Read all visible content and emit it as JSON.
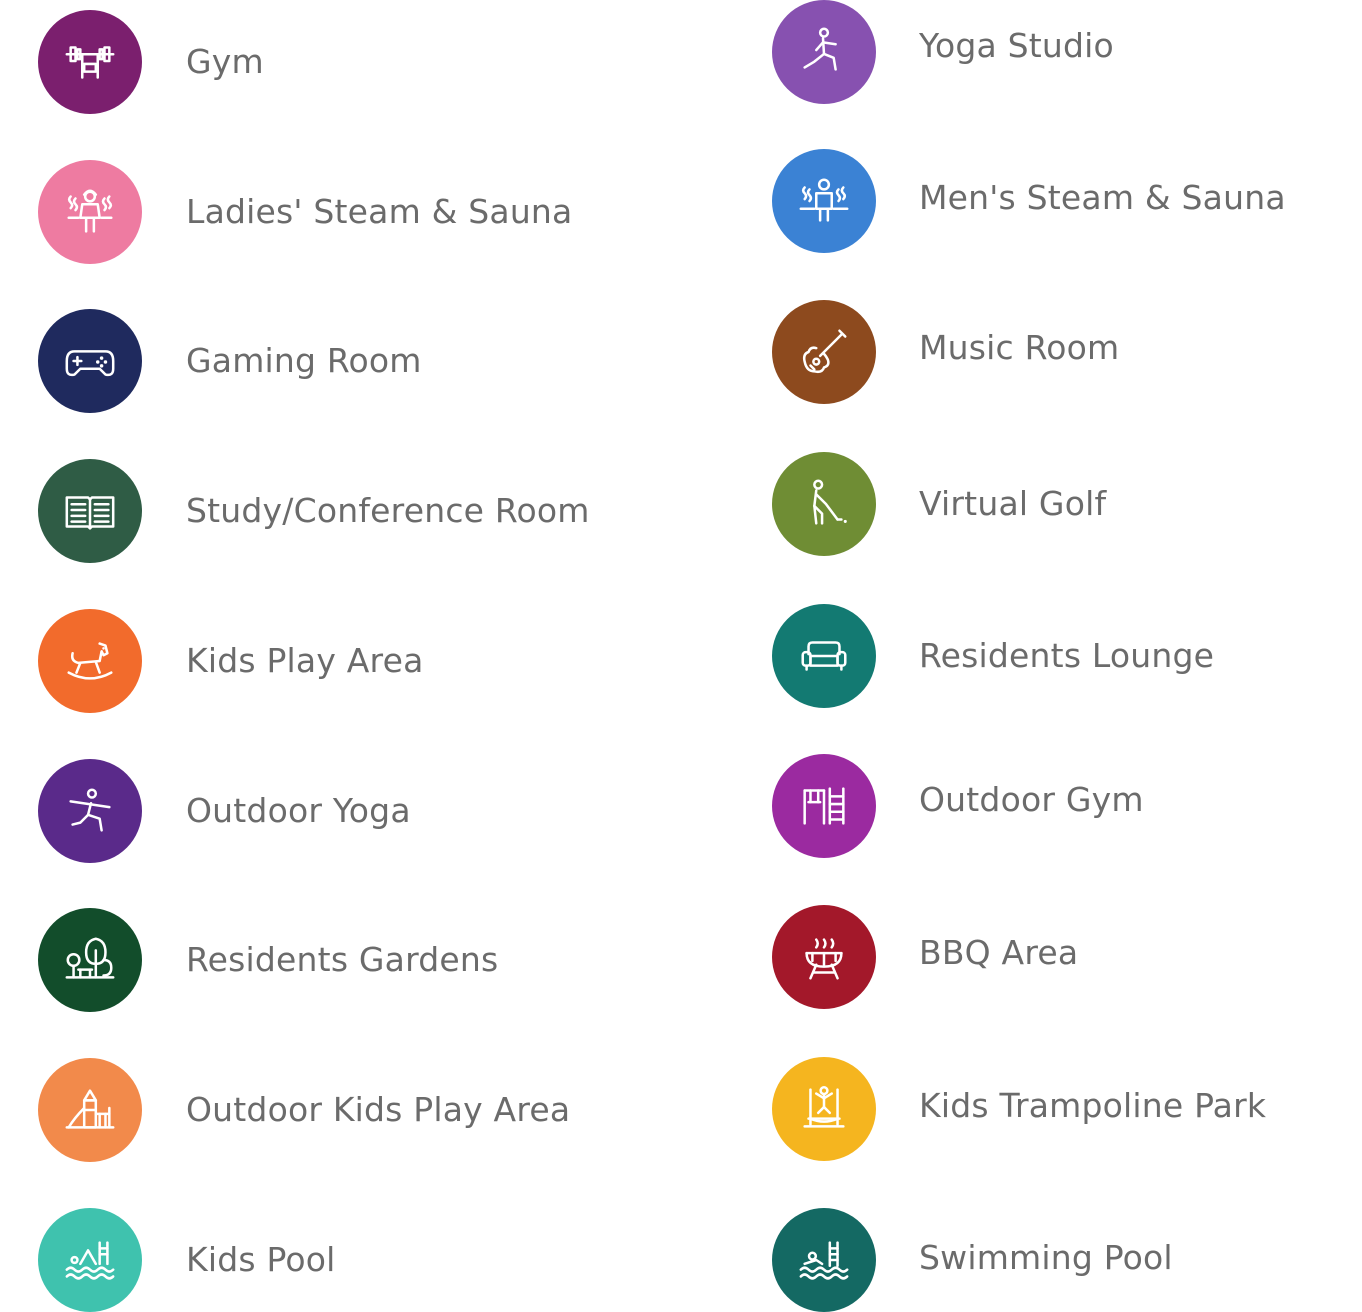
{
  "amenities": {
    "left": [
      {
        "label": "Gym",
        "icon": "barbell-bench-icon",
        "color": "#7b1f6e"
      },
      {
        "label": "Ladies' Steam & Sauna",
        "icon": "woman-sauna-icon",
        "color": "#ee7ba1"
      },
      {
        "label": "Gaming Room",
        "icon": "game-controller-icon",
        "color": "#1f2a5e"
      },
      {
        "label": "Study/Conference Room",
        "icon": "open-book-icon",
        "color": "#2f5c45"
      },
      {
        "label": "Kids Play Area",
        "icon": "rocking-horse-icon",
        "color": "#f26b2c"
      },
      {
        "label": "Outdoor Yoga",
        "icon": "yoga-pose-icon",
        "color": "#5a2a8a"
      },
      {
        "label": "Residents Gardens",
        "icon": "tree-bench-icon",
        "color": "#124d2b"
      },
      {
        "label": "Outdoor Kids Play Area",
        "icon": "playground-slide-icon",
        "color": "#f28a4b"
      },
      {
        "label": "Kids Pool",
        "icon": "kids-pool-icon",
        "color": "#3fc2ae"
      }
    ],
    "right": [
      {
        "label": "Yoga Studio",
        "icon": "yoga-lunge-icon",
        "color": "#8751b0"
      },
      {
        "label": "Men's Steam & Sauna",
        "icon": "man-sauna-icon",
        "color": "#3b82d4"
      },
      {
        "label": "Music Room",
        "icon": "guitar-icon",
        "color": "#8d4a1e"
      },
      {
        "label": "Virtual Golf",
        "icon": "golfer-icon",
        "color": "#6f8d34"
      },
      {
        "label": "Residents Lounge",
        "icon": "sofa-icon",
        "color": "#137a72"
      },
      {
        "label": "Outdoor Gym",
        "icon": "gym-frame-icon",
        "color": "#9b2aa0"
      },
      {
        "label": "BBQ Area",
        "icon": "bbq-grill-icon",
        "color": "#a3182a"
      },
      {
        "label": "Kids Trampoline Park",
        "icon": "trampoline-icon",
        "color": "#f5b51f"
      },
      {
        "label": "Swimming Pool",
        "icon": "swimming-pool-icon",
        "color": "#146963"
      }
    ]
  }
}
